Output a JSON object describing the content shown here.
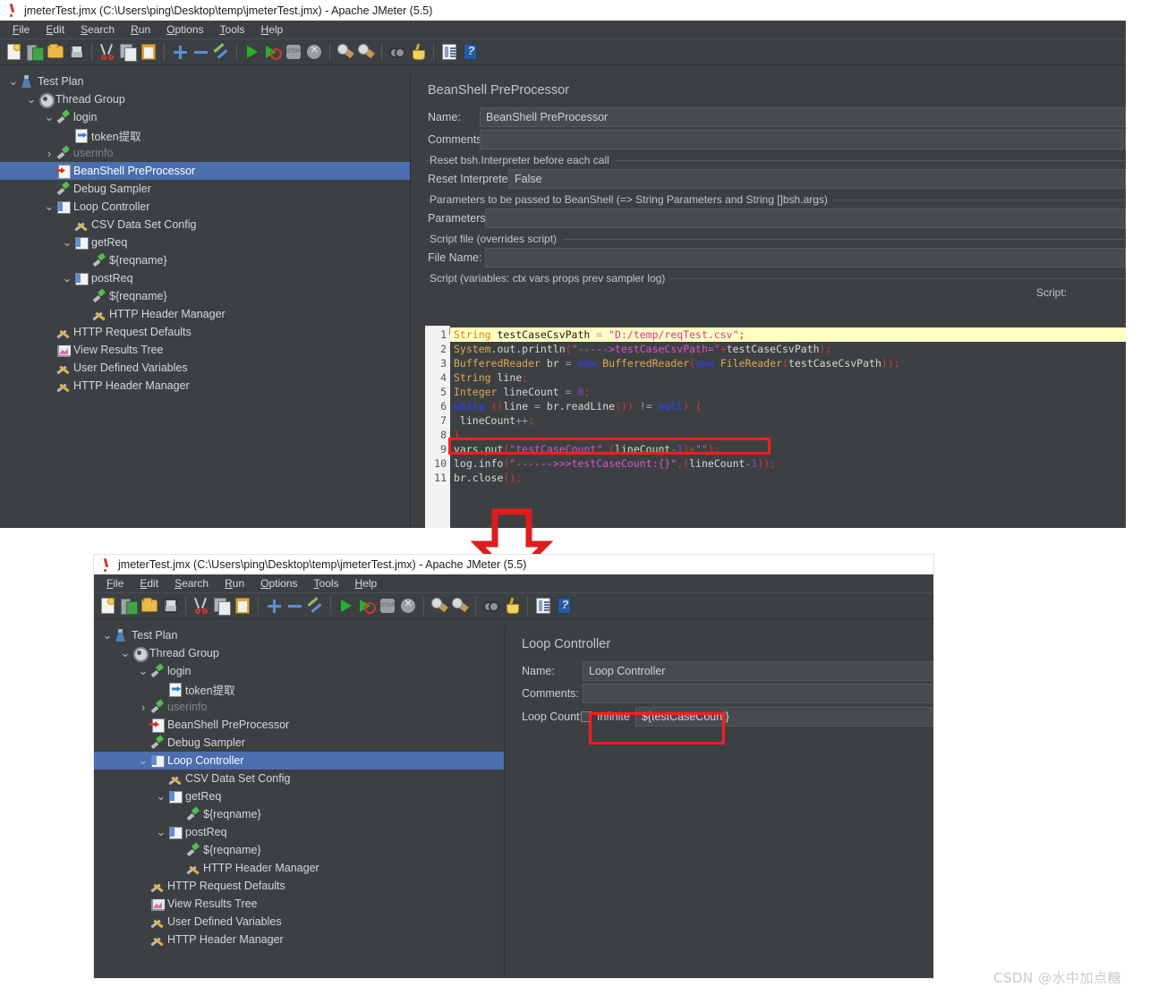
{
  "top_window": {
    "title": "jmeterTest.jmx (C:\\Users\\ping\\Desktop\\temp\\jmeterTest.jmx) - Apache JMeter (5.5)",
    "menu": [
      "File",
      "Edit",
      "Search",
      "Run",
      "Options",
      "Tools",
      "Help"
    ],
    "toolbar_icons": [
      "new-icon",
      "templates-icon",
      "open-icon",
      "save-icon",
      "cut-icon",
      "copy-icon",
      "paste-icon",
      "expand-icon",
      "collapse-icon",
      "toggle-icon",
      "start-icon",
      "start-no-pauses-icon",
      "stop-icon",
      "shutdown-icon",
      "clear-icon",
      "clear-all-icon",
      "search-icon",
      "reset-search-icon",
      "function-helper-icon",
      "help-icon"
    ],
    "tree": [
      {
        "label": "Test Plan",
        "icon": "test-plan-icon",
        "depth": 0,
        "twist": "v",
        "selected": false,
        "disabled": false
      },
      {
        "label": "Thread Group",
        "icon": "thread-group-icon",
        "depth": 1,
        "twist": "v",
        "selected": false,
        "disabled": false
      },
      {
        "label": "login",
        "icon": "sampler-icon",
        "depth": 2,
        "twist": "v",
        "selected": false,
        "disabled": false
      },
      {
        "label": "token提取",
        "icon": "extractor-icon",
        "depth": 3,
        "twist": "",
        "selected": false,
        "disabled": false
      },
      {
        "label": "userinfo",
        "icon": "sampler-icon",
        "depth": 2,
        "twist": ">",
        "selected": false,
        "disabled": true
      },
      {
        "label": "BeanShell PreProcessor",
        "icon": "preprocessor-icon",
        "depth": 2,
        "twist": "",
        "selected": true,
        "disabled": false
      },
      {
        "label": "Debug Sampler",
        "icon": "sampler-icon",
        "depth": 2,
        "twist": "",
        "selected": false,
        "disabled": false
      },
      {
        "label": "Loop Controller",
        "icon": "controller-icon",
        "depth": 2,
        "twist": "v",
        "selected": false,
        "disabled": false
      },
      {
        "label": "CSV Data Set Config",
        "icon": "config-icon",
        "depth": 3,
        "twist": "",
        "selected": false,
        "disabled": false
      },
      {
        "label": "getReq",
        "icon": "controller-icon",
        "depth": 3,
        "twist": "v",
        "selected": false,
        "disabled": false
      },
      {
        "label": "${reqname}",
        "icon": "sampler-icon",
        "depth": 4,
        "twist": "",
        "selected": false,
        "disabled": false
      },
      {
        "label": "postReq",
        "icon": "controller-icon",
        "depth": 3,
        "twist": "v",
        "selected": false,
        "disabled": false
      },
      {
        "label": "${reqname}",
        "icon": "sampler-icon",
        "depth": 4,
        "twist": "",
        "selected": false,
        "disabled": false
      },
      {
        "label": "HTTP Header Manager",
        "icon": "config-icon",
        "depth": 4,
        "twist": "",
        "selected": false,
        "disabled": false
      },
      {
        "label": "HTTP Request Defaults",
        "icon": "config-icon",
        "depth": 2,
        "twist": "",
        "selected": false,
        "disabled": false
      },
      {
        "label": "View Results Tree",
        "icon": "results-tree-icon",
        "depth": 2,
        "twist": "",
        "selected": false,
        "disabled": false
      },
      {
        "label": "User Defined Variables",
        "icon": "config-icon",
        "depth": 2,
        "twist": "",
        "selected": false,
        "disabled": false
      },
      {
        "label": "HTTP Header Manager",
        "icon": "config-icon",
        "depth": 2,
        "twist": "",
        "selected": false,
        "disabled": false
      }
    ],
    "pane": {
      "title": "BeanShell PreProcessor",
      "name_label": "Name:",
      "name_value": "BeanShell PreProcessor",
      "comments_label": "Comments:",
      "comments_value": "",
      "reset_group_legend": "Reset bsh.Interpreter before each call",
      "reset_label": "Reset Interpreter:",
      "reset_value": "False",
      "params_group_legend": "Parameters to be passed to BeanShell (=> String Parameters and String []bsh.args)",
      "params_label": "Parameters:",
      "params_value": "",
      "scriptfile_group_legend": "Script file (overrides script)",
      "filename_label": "File Name:",
      "filename_value": "",
      "script_group_legend": "Script (variables: ctx vars props prev sampler log)",
      "script_caption": "Script:"
    },
    "code_lines": [
      {
        "n": "1",
        "fold": true,
        "hl": true,
        "tokens": [
          {
            "t": "String",
            "c": "k-type"
          },
          {
            "t": " testCaseCsvPath ",
            "c": "k-id"
          },
          {
            "t": "=",
            "c": "k-op"
          },
          {
            "t": " ",
            "c": "k-id"
          },
          {
            "t": "\"D:/temp/reqTest.csv\"",
            "c": "k-str"
          },
          {
            "t": ";",
            "c": "k-punc"
          }
        ]
      },
      {
        "n": "2",
        "fold": false,
        "hl": false,
        "tokens": [
          {
            "t": "System",
            "c": "k-type"
          },
          {
            "t": ".out.println",
            "c": "k-id"
          },
          {
            "t": "(",
            "c": "k-punc"
          },
          {
            "t": "\"----->testCaseCsvPath=\"",
            "c": "k-str"
          },
          {
            "t": "+",
            "c": "k-punc"
          },
          {
            "t": "testCaseCsvPath",
            "c": "k-id"
          },
          {
            "t": ");",
            "c": "k-punc"
          }
        ]
      },
      {
        "n": "3",
        "fold": false,
        "hl": false,
        "tokens": [
          {
            "t": "BufferedReader",
            "c": "k-type"
          },
          {
            "t": " br ",
            "c": "k-id"
          },
          {
            "t": "=",
            "c": "k-op"
          },
          {
            "t": " ",
            "c": "k-id"
          },
          {
            "t": "new",
            "c": "k-kw"
          },
          {
            "t": " ",
            "c": "k-id"
          },
          {
            "t": "BufferedReader",
            "c": "k-type"
          },
          {
            "t": "(",
            "c": "k-punc"
          },
          {
            "t": "new",
            "c": "k-kw"
          },
          {
            "t": " ",
            "c": "k-id"
          },
          {
            "t": "FileReader",
            "c": "k-type"
          },
          {
            "t": "(",
            "c": "k-punc"
          },
          {
            "t": "testCaseCsvPath",
            "c": "k-id"
          },
          {
            "t": "));",
            "c": "k-punc"
          }
        ]
      },
      {
        "n": "4",
        "fold": false,
        "hl": false,
        "tokens": [
          {
            "t": "String",
            "c": "k-type"
          },
          {
            "t": " line",
            "c": "k-id"
          },
          {
            "t": ";",
            "c": "k-punc"
          }
        ]
      },
      {
        "n": "5",
        "fold": false,
        "hl": false,
        "tokens": [
          {
            "t": "Integer",
            "c": "k-type"
          },
          {
            "t": " lineCount ",
            "c": "k-id"
          },
          {
            "t": "=",
            "c": "k-op"
          },
          {
            "t": " ",
            "c": "k-id"
          },
          {
            "t": "0",
            "c": "k-num"
          },
          {
            "t": ";",
            "c": "k-punc"
          }
        ]
      },
      {
        "n": "6",
        "fold": false,
        "hl": false,
        "tokens": [
          {
            "t": "while",
            "c": "k-kw"
          },
          {
            "t": " ",
            "c": "k-id"
          },
          {
            "t": "((",
            "c": "k-punc"
          },
          {
            "t": "line ",
            "c": "k-id"
          },
          {
            "t": "=",
            "c": "k-op"
          },
          {
            "t": " br.readLine",
            "c": "k-id"
          },
          {
            "t": "())",
            "c": "k-punc"
          },
          {
            "t": " ",
            "c": "k-id"
          },
          {
            "t": "!=",
            "c": "k-op"
          },
          {
            "t": " ",
            "c": "k-id"
          },
          {
            "t": "null",
            "c": "k-kw"
          },
          {
            "t": ") {",
            "c": "k-punc"
          }
        ]
      },
      {
        "n": "7",
        "fold": false,
        "hl": false,
        "tokens": [
          {
            "t": " lineCount",
            "c": "k-id"
          },
          {
            "t": "++",
            "c": "k-op"
          },
          {
            "t": ";",
            "c": "k-punc"
          }
        ]
      },
      {
        "n": "8",
        "fold": false,
        "hl": false,
        "tokens": [
          {
            "t": "}",
            "c": "k-punc"
          }
        ]
      },
      {
        "n": "9",
        "fold": false,
        "hl": false,
        "tokens": [
          {
            "t": "vars.put",
            "c": "k-id"
          },
          {
            "t": "(",
            "c": "k-punc"
          },
          {
            "t": "\"testCaseCount\"",
            "c": "k-str"
          },
          {
            "t": ",(",
            "c": "k-punc"
          },
          {
            "t": "lineCount",
            "c": "k-id"
          },
          {
            "t": "-",
            "c": "k-op"
          },
          {
            "t": "1",
            "c": "k-num"
          },
          {
            "t": ")+",
            "c": "k-punc"
          },
          {
            "t": "\"\"",
            "c": "k-str"
          },
          {
            "t": ");",
            "c": "k-punc"
          }
        ]
      },
      {
        "n": "10",
        "fold": false,
        "hl": false,
        "tokens": [
          {
            "t": "log.info",
            "c": "k-id"
          },
          {
            "t": "(",
            "c": "k-punc"
          },
          {
            "t": "\"------>>>testCaseCount:{}\"",
            "c": "k-str"
          },
          {
            "t": ",(",
            "c": "k-punc"
          },
          {
            "t": "lineCount",
            "c": "k-id"
          },
          {
            "t": "-",
            "c": "k-op"
          },
          {
            "t": "1",
            "c": "k-num"
          },
          {
            "t": "));",
            "c": "k-punc"
          }
        ]
      },
      {
        "n": "11",
        "fold": false,
        "hl": false,
        "tokens": [
          {
            "t": "br.close",
            "c": "k-id"
          },
          {
            "t": "();",
            "c": "k-punc"
          }
        ]
      }
    ]
  },
  "bottom_window": {
    "title": "jmeterTest.jmx (C:\\Users\\ping\\Desktop\\temp\\jmeterTest.jmx) - Apache JMeter (5.5)",
    "menu": [
      "File",
      "Edit",
      "Search",
      "Run",
      "Options",
      "Tools",
      "Help"
    ],
    "tree": [
      {
        "label": "Test Plan",
        "icon": "test-plan-icon",
        "depth": 0,
        "twist": "v",
        "selected": false,
        "disabled": false
      },
      {
        "label": "Thread Group",
        "icon": "thread-group-icon",
        "depth": 1,
        "twist": "v",
        "selected": false,
        "disabled": false
      },
      {
        "label": "login",
        "icon": "sampler-icon",
        "depth": 2,
        "twist": "v",
        "selected": false,
        "disabled": false
      },
      {
        "label": "token提取",
        "icon": "extractor-icon",
        "depth": 3,
        "twist": "",
        "selected": false,
        "disabled": false
      },
      {
        "label": "userinfo",
        "icon": "sampler-icon",
        "depth": 2,
        "twist": ">",
        "selected": false,
        "disabled": true
      },
      {
        "label": "BeanShell PreProcessor",
        "icon": "preprocessor-icon",
        "depth": 2,
        "twist": "",
        "selected": false,
        "disabled": false
      },
      {
        "label": "Debug Sampler",
        "icon": "sampler-icon",
        "depth": 2,
        "twist": "",
        "selected": false,
        "disabled": false
      },
      {
        "label": "Loop Controller",
        "icon": "controller-icon",
        "depth": 2,
        "twist": "v",
        "selected": true,
        "disabled": false
      },
      {
        "label": "CSV Data Set Config",
        "icon": "config-icon",
        "depth": 3,
        "twist": "",
        "selected": false,
        "disabled": false
      },
      {
        "label": "getReq",
        "icon": "controller-icon",
        "depth": 3,
        "twist": "v",
        "selected": false,
        "disabled": false
      },
      {
        "label": "${reqname}",
        "icon": "sampler-icon",
        "depth": 4,
        "twist": "",
        "selected": false,
        "disabled": false
      },
      {
        "label": "postReq",
        "icon": "controller-icon",
        "depth": 3,
        "twist": "v",
        "selected": false,
        "disabled": false
      },
      {
        "label": "${reqname}",
        "icon": "sampler-icon",
        "depth": 4,
        "twist": "",
        "selected": false,
        "disabled": false
      },
      {
        "label": "HTTP Header Manager",
        "icon": "config-icon",
        "depth": 4,
        "twist": "",
        "selected": false,
        "disabled": false
      },
      {
        "label": "HTTP Request Defaults",
        "icon": "config-icon",
        "depth": 2,
        "twist": "",
        "selected": false,
        "disabled": false
      },
      {
        "label": "View Results Tree",
        "icon": "results-tree-icon",
        "depth": 2,
        "twist": "",
        "selected": false,
        "disabled": false
      },
      {
        "label": "User Defined Variables",
        "icon": "config-icon",
        "depth": 2,
        "twist": "",
        "selected": false,
        "disabled": false
      },
      {
        "label": "HTTP Header Manager",
        "icon": "config-icon",
        "depth": 2,
        "twist": "",
        "selected": false,
        "disabled": false
      }
    ],
    "pane": {
      "title": "Loop Controller",
      "name_label": "Name:",
      "name_value": "Loop Controller",
      "comments_label": "Comments:",
      "comments_value": "",
      "loop_count_label": "Loop Count:",
      "infinite_label": "Infinite",
      "infinite_checked": false,
      "loop_count_value": "${testCaseCount}"
    }
  },
  "annotations": {
    "highlight_color": "#ff1d1d",
    "down_arrow": "down-arrow-annotation",
    "pointer_arrow": "up-arrow-annotation",
    "code_box": "code-highlight-box",
    "loop_count_box": "loop-count-highlight-box"
  },
  "watermark": {
    "text": "CSDN @水中加点糖"
  }
}
